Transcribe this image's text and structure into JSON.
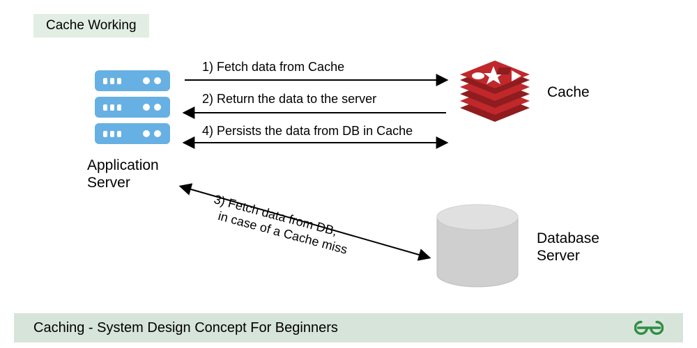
{
  "header": {
    "title": "Cache Working"
  },
  "footer": {
    "title": "Caching - System Design Concept For Beginners"
  },
  "nodes": {
    "app_server": {
      "label": "Application\nServer"
    },
    "cache": {
      "label": "Cache"
    },
    "db": {
      "label": "Database\nServer"
    }
  },
  "steps": {
    "s1": "1) Fetch data from Cache",
    "s2": "2) Return the data to the server",
    "s3a": "3) Fetch data from DB,",
    "s3b": "in case of a Cache miss",
    "s4": "4) Persists the data from DB in Cache"
  },
  "colors": {
    "server": "#67b0e3",
    "cache": "#c0282b",
    "db_top": "#e0e0e0",
    "db_body": "#cfcfcf",
    "pill": "#e2eee4",
    "footer": "#d7e4d9",
    "gfg": "#2f8d46"
  }
}
